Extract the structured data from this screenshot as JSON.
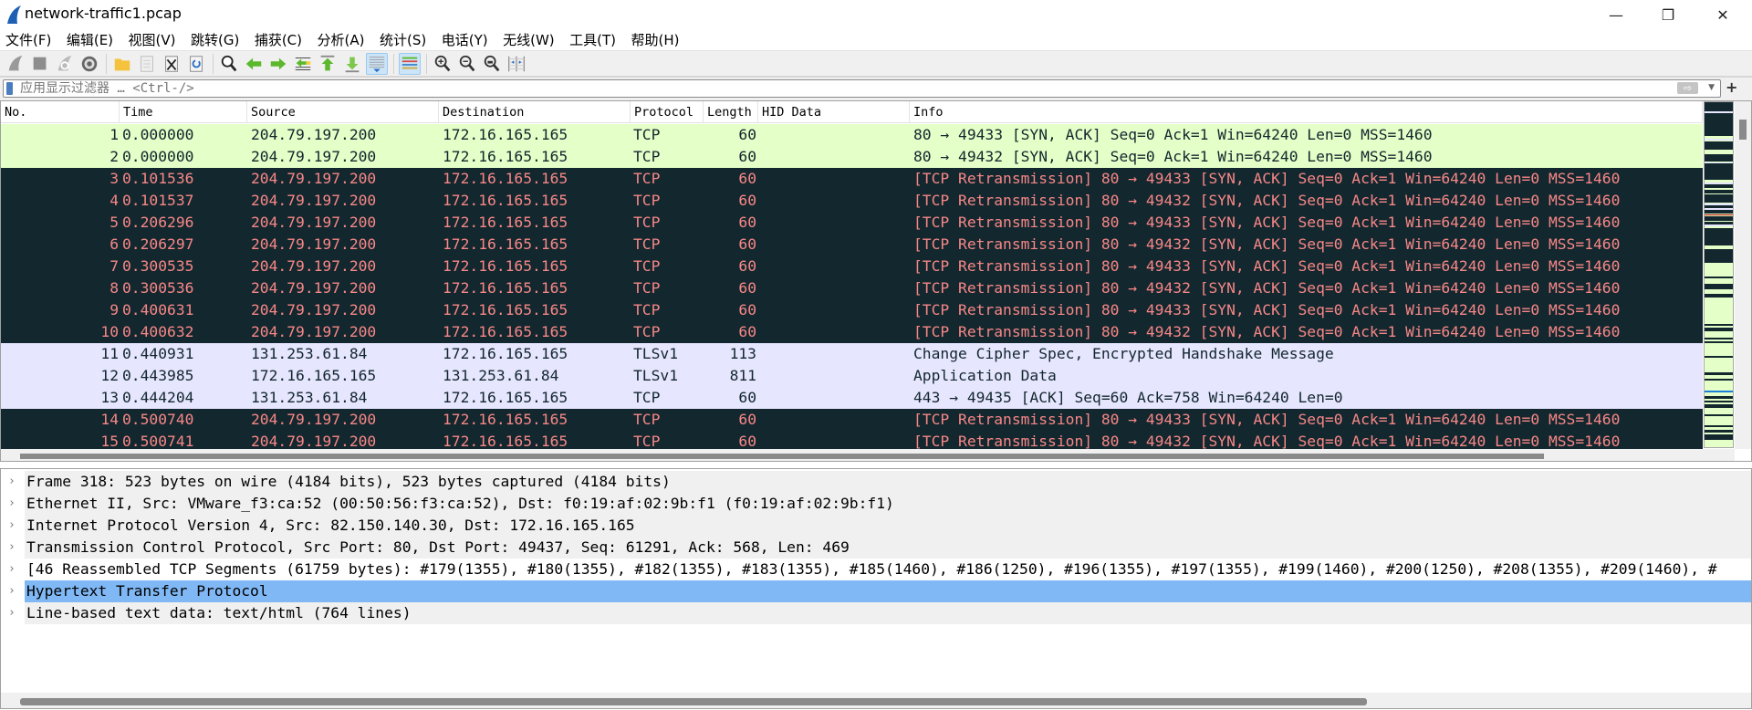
{
  "window": {
    "title": "network-traffic1.pcap",
    "minimize": "—",
    "restore": "❐",
    "close": "✕"
  },
  "menu": [
    "文件(F)",
    "编辑(E)",
    "视图(V)",
    "跳转(G)",
    "捕获(C)",
    "分析(A)",
    "统计(S)",
    "电话(Y)",
    "无线(W)",
    "工具(T)",
    "帮助(H)"
  ],
  "toolbar": [
    "start-capture",
    "stop-capture",
    "restart-capture",
    "capture-options",
    "|",
    "open-file",
    "save-file",
    "close-file",
    "reload-file",
    "|",
    "find-packet",
    "go-back",
    "go-forward",
    "go-to-packet",
    "go-first",
    "go-last",
    "auto-scroll",
    "|",
    "colorize",
    "|",
    "zoom-in",
    "zoom-out",
    "zoom-normal",
    "resize-columns"
  ],
  "filter": {
    "placeholder": "应用显示过滤器 … <Ctrl-/>",
    "apply": "⇨",
    "add": "+"
  },
  "columns": [
    "No.",
    "Time",
    "Source",
    "Destination",
    "Protocol",
    "Length",
    "HID Data",
    "Info"
  ],
  "packets": [
    {
      "no": "1",
      "time": "0.000000",
      "src": "204.79.197.200",
      "dst": "172.16.165.165",
      "proto": "TCP",
      "len": "60",
      "info": "80 → 49433 [SYN, ACK] Seq=0 Ack=1 Win=64240 Len=0 MSS=1460",
      "color": "green"
    },
    {
      "no": "2",
      "time": "0.000000",
      "src": "204.79.197.200",
      "dst": "172.16.165.165",
      "proto": "TCP",
      "len": "60",
      "info": "80 → 49432 [SYN, ACK] Seq=0 Ack=1 Win=64240 Len=0 MSS=1460",
      "color": "green"
    },
    {
      "no": "3",
      "time": "0.101536",
      "src": "204.79.197.200",
      "dst": "172.16.165.165",
      "proto": "TCP",
      "len": "60",
      "info": "[TCP Retransmission] 80 → 49433 [SYN, ACK] Seq=0 Ack=1 Win=64240 Len=0 MSS=1460",
      "color": "dark"
    },
    {
      "no": "4",
      "time": "0.101537",
      "src": "204.79.197.200",
      "dst": "172.16.165.165",
      "proto": "TCP",
      "len": "60",
      "info": "[TCP Retransmission] 80 → 49432 [SYN, ACK] Seq=0 Ack=1 Win=64240 Len=0 MSS=1460",
      "color": "dark"
    },
    {
      "no": "5",
      "time": "0.206296",
      "src": "204.79.197.200",
      "dst": "172.16.165.165",
      "proto": "TCP",
      "len": "60",
      "info": "[TCP Retransmission] 80 → 49433 [SYN, ACK] Seq=0 Ack=1 Win=64240 Len=0 MSS=1460",
      "color": "dark"
    },
    {
      "no": "6",
      "time": "0.206297",
      "src": "204.79.197.200",
      "dst": "172.16.165.165",
      "proto": "TCP",
      "len": "60",
      "info": "[TCP Retransmission] 80 → 49432 [SYN, ACK] Seq=0 Ack=1 Win=64240 Len=0 MSS=1460",
      "color": "dark"
    },
    {
      "no": "7",
      "time": "0.300535",
      "src": "204.79.197.200",
      "dst": "172.16.165.165",
      "proto": "TCP",
      "len": "60",
      "info": "[TCP Retransmission] 80 → 49433 [SYN, ACK] Seq=0 Ack=1 Win=64240 Len=0 MSS=1460",
      "color": "dark"
    },
    {
      "no": "8",
      "time": "0.300536",
      "src": "204.79.197.200",
      "dst": "172.16.165.165",
      "proto": "TCP",
      "len": "60",
      "info": "[TCP Retransmission] 80 → 49432 [SYN, ACK] Seq=0 Ack=1 Win=64240 Len=0 MSS=1460",
      "color": "dark"
    },
    {
      "no": "9",
      "time": "0.400631",
      "src": "204.79.197.200",
      "dst": "172.16.165.165",
      "proto": "TCP",
      "len": "60",
      "info": "[TCP Retransmission] 80 → 49433 [SYN, ACK] Seq=0 Ack=1 Win=64240 Len=0 MSS=1460",
      "color": "dark"
    },
    {
      "no": "10",
      "time": "0.400632",
      "src": "204.79.197.200",
      "dst": "172.16.165.165",
      "proto": "TCP",
      "len": "60",
      "info": "[TCP Retransmission] 80 → 49432 [SYN, ACK] Seq=0 Ack=1 Win=64240 Len=0 MSS=1460",
      "color": "dark"
    },
    {
      "no": "11",
      "time": "0.440931",
      "src": "131.253.61.84",
      "dst": "172.16.165.165",
      "proto": "TLSv1",
      "len": "113",
      "info": "Change Cipher Spec, Encrypted Handshake Message",
      "color": "lav"
    },
    {
      "no": "12",
      "time": "0.443985",
      "src": "172.16.165.165",
      "dst": "131.253.61.84",
      "proto": "TLSv1",
      "len": "811",
      "info": "Application Data",
      "color": "lav"
    },
    {
      "no": "13",
      "time": "0.444204",
      "src": "131.253.61.84",
      "dst": "172.16.165.165",
      "proto": "TCP",
      "len": "60",
      "info": "443 → 49435 [ACK] Seq=60 Ack=758 Win=64240 Len=0",
      "color": "lav"
    },
    {
      "no": "14",
      "time": "0.500740",
      "src": "204.79.197.200",
      "dst": "172.16.165.165",
      "proto": "TCP",
      "len": "60",
      "info": "[TCP Retransmission] 80 → 49433 [SYN, ACK] Seq=0 Ack=1 Win=64240 Len=0 MSS=1460",
      "color": "dark"
    },
    {
      "no": "15",
      "time": "0.500741",
      "src": "204.79.197.200",
      "dst": "172.16.165.165",
      "proto": "TCP",
      "len": "60",
      "info": "[TCP Retransmission] 80 → 49432 [SYN, ACK] Seq=0 Ack=1 Win=64240 Len=0 MSS=1460",
      "color": "dark"
    }
  ],
  "details": [
    {
      "text": "Frame 318: 523 bytes on wire (4184 bits), 523 bytes captured (4184 bits)",
      "style": "grey"
    },
    {
      "text": "Ethernet II, Src: VMware_f3:ca:52 (00:50:56:f3:ca:52), Dst: f0:19:af:02:9b:f1 (f0:19:af:02:9b:f1)",
      "style": "grey"
    },
    {
      "text": "Internet Protocol Version 4, Src: 82.150.140.30, Dst: 172.16.165.165",
      "style": "grey"
    },
    {
      "text": "Transmission Control Protocol, Src Port: 80, Dst Port: 49437, Seq: 61291, Ack: 568, Len: 469",
      "style": "grey"
    },
    {
      "text": "[46 Reassembled TCP Segments (61759 bytes): #179(1355), #180(1355), #182(1355), #183(1355), #185(1460), #186(1250), #196(1355), #197(1355), #199(1460), #200(1250), #208(1355), #209(1460), #",
      "style": "white"
    },
    {
      "text": "Hypertext Transfer Protocol",
      "style": "sel"
    },
    {
      "text": "Line-based text data: text/html (764 lines)",
      "style": "grey"
    }
  ],
  "colors": {
    "green": "#e4ffc7",
    "dark": "#12272e",
    "dark_text": "#f78787",
    "lavender": "#e7e6ff",
    "selected": "#80b8f5"
  }
}
